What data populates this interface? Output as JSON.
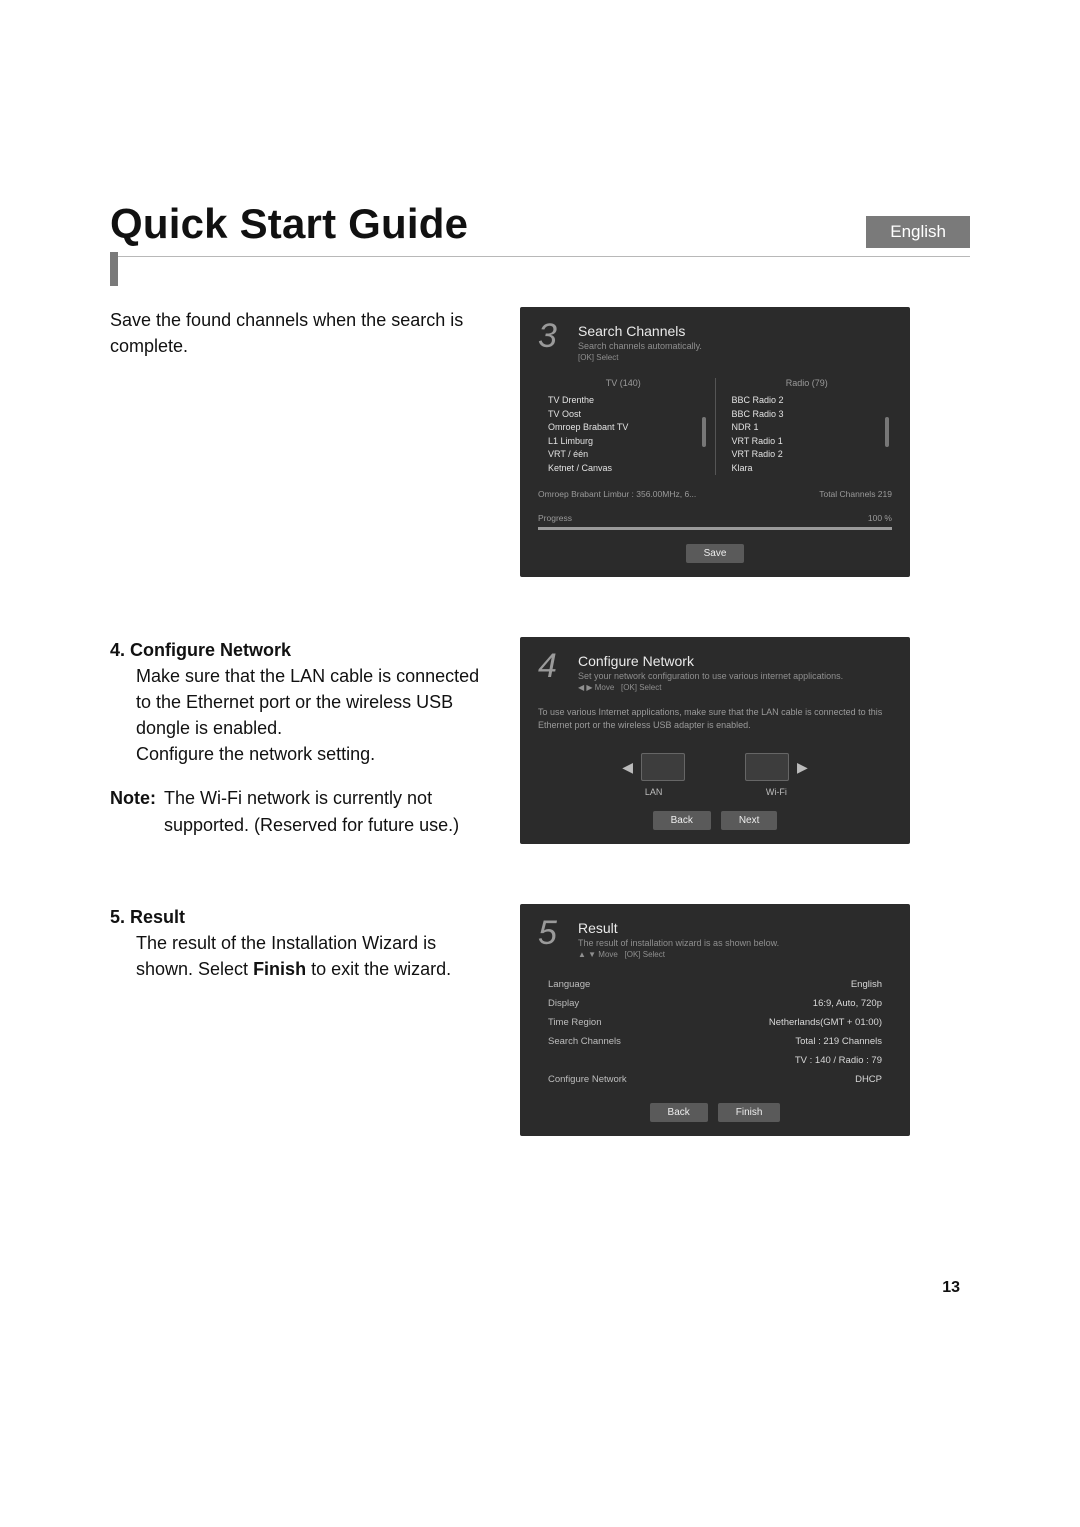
{
  "header": {
    "title": "Quick Start Guide",
    "language": "English"
  },
  "section_save": {
    "text": "Save the found channels when the search is complete."
  },
  "shot3": {
    "step": "3",
    "title": "Search Channels",
    "sub": "Search channels automatically.",
    "hint": "[OK] Select",
    "tv_head": "TV (140)",
    "radio_head": "Radio (79)",
    "tv_list": [
      "TV Drenthe",
      "TV Oost",
      "Omroep Brabant TV",
      "L1 Limburg",
      "VRT / één",
      "Ketnet / Canvas"
    ],
    "radio_list": [
      "BBC Radio 2",
      "BBC Radio 3",
      "NDR 1",
      "VRT Radio 1",
      "VRT Radio 2",
      "Klara"
    ],
    "progress_left": "Omroep Brabant Limbur : 356.00MHz, 6...",
    "progress_right": "Total Channels 219",
    "progress_label": "Progress",
    "progress_pct": "100 %",
    "save_btn": "Save"
  },
  "section4": {
    "num": "4.",
    "label": "Configure Network",
    "line1": "Make sure that the LAN cable is connected to the Ethernet port or the wireless USB dongle is enabled.",
    "line2": "Configure the network setting.",
    "note_label": "Note:",
    "note_text": "The Wi-Fi network is currently not supported. (Reserved for future use.)"
  },
  "shot4": {
    "step": "4",
    "title": "Configure Network",
    "sub": "Set your network configuration to use various internet applications.",
    "hint1": "◀ ▶ Move",
    "hint2": "[OK] Select",
    "body": "To use various Internet applications, make sure that the LAN cable is connected to this Ethernet port or the wireless USB adapter is enabled.",
    "opt_lan": "LAN",
    "opt_wifi": "Wi-Fi",
    "back_btn": "Back",
    "next_btn": "Next"
  },
  "section5": {
    "num": "5.",
    "label": "Result",
    "line1": "The result of the Installation Wizard is shown. Select ",
    "bold": "Finish",
    "line1_tail": " to exit the wizard."
  },
  "shot5": {
    "step": "5",
    "title": "Result",
    "sub": "The result of installation wizard is as shown below.",
    "hint1": "▲ ▼ Move",
    "hint2": "[OK] Select",
    "rows": [
      {
        "k": "Language",
        "v": "English"
      },
      {
        "k": "Display",
        "v": "16:9, Auto, 720p"
      },
      {
        "k": "Time Region",
        "v": "Netherlands(GMT + 01:00)"
      },
      {
        "k": "Search Channels",
        "v": "Total : 219 Channels"
      },
      {
        "k": "",
        "v": "TV : 140 / Radio : 79"
      },
      {
        "k": "Configure Network",
        "v": "DHCP"
      }
    ],
    "back_btn": "Back",
    "finish_btn": "Finish"
  },
  "page_number": "13"
}
